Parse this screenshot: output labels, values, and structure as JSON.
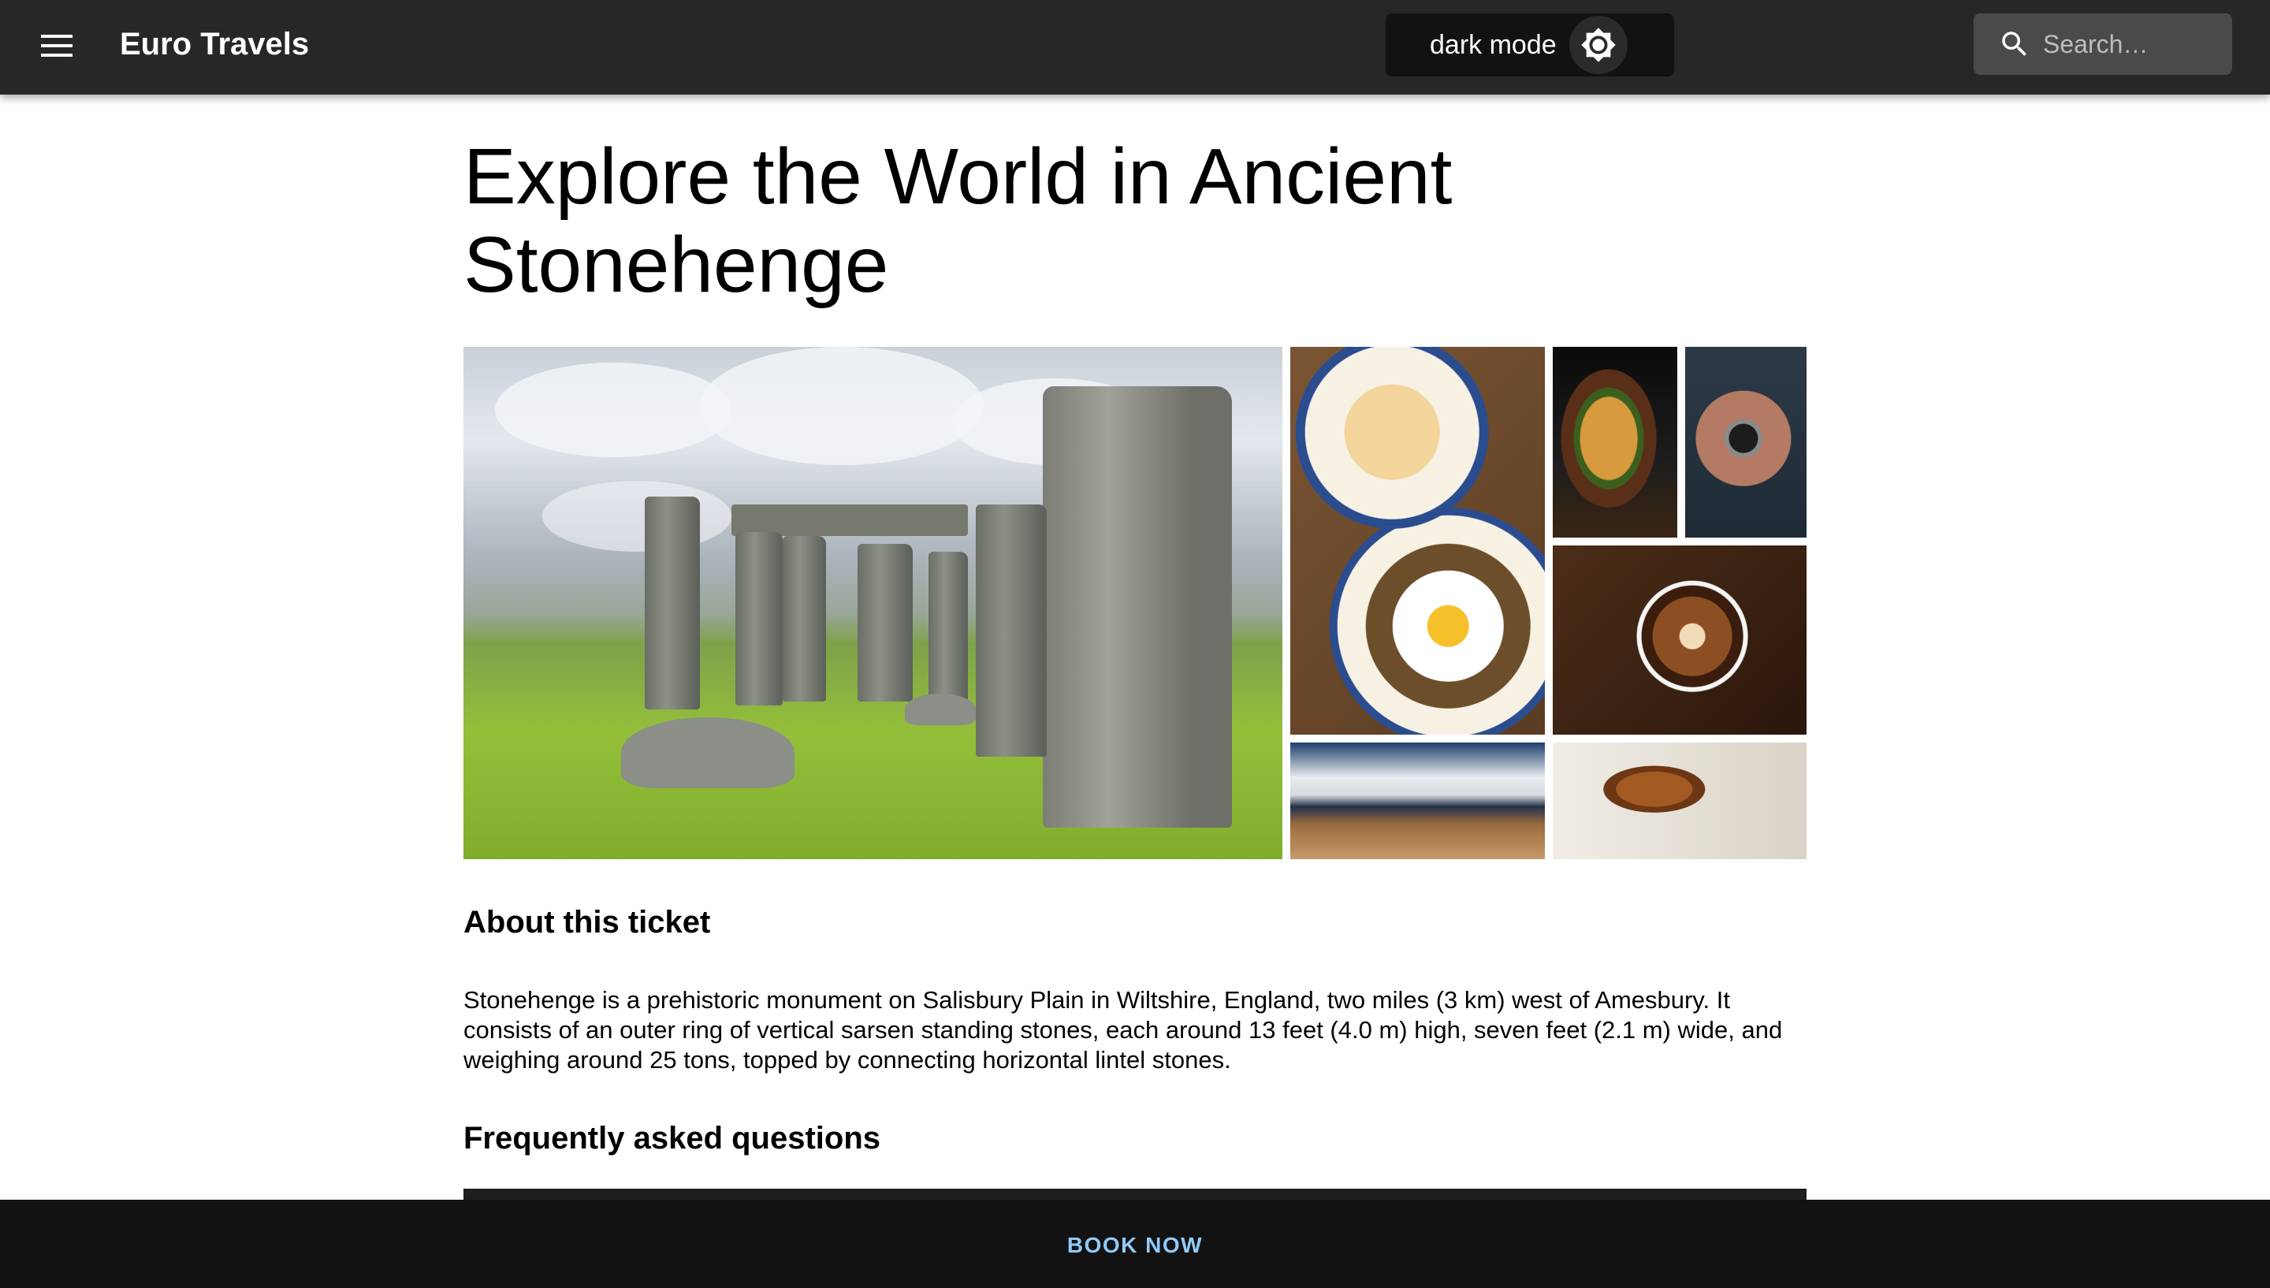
{
  "header": {
    "title": "Euro Travels",
    "dark_mode_label": "dark mode",
    "search_placeholder": "Search…"
  },
  "main": {
    "title": "Explore the World in Ancient Stonehenge",
    "gallery": [
      {
        "icon": "stonehenge-photo"
      },
      {
        "icon": "breakfast-photo"
      },
      {
        "icon": "burger-photo"
      },
      {
        "icon": "camera-photo"
      },
      {
        "icon": "coffee-photo"
      },
      {
        "icon": "shoes-photo"
      },
      {
        "icon": "honey-dipper-photo"
      }
    ],
    "about_heading": "About this ticket",
    "about_text": "Stonehenge is a prehistoric monument on Salisbury Plain in Wiltshire, England, two miles (3 km) west of Amesbury. It consists of an outer ring of vertical sarsen standing stones, each around 13 feet (4.0 m) high, seven feet (2.1 m) wide, and weighing around 25 tons, topped by connecting horizontal lintel stones.",
    "faq_heading": "Frequently asked questions"
  },
  "footer": {
    "book_label": "BOOK NOW"
  },
  "colors": {
    "appbar": "#272727",
    "darkmode_button": "#121212",
    "search_box": "#4a4a4a",
    "bottom_bar": "#121212",
    "book_accent": "#90caf9"
  }
}
